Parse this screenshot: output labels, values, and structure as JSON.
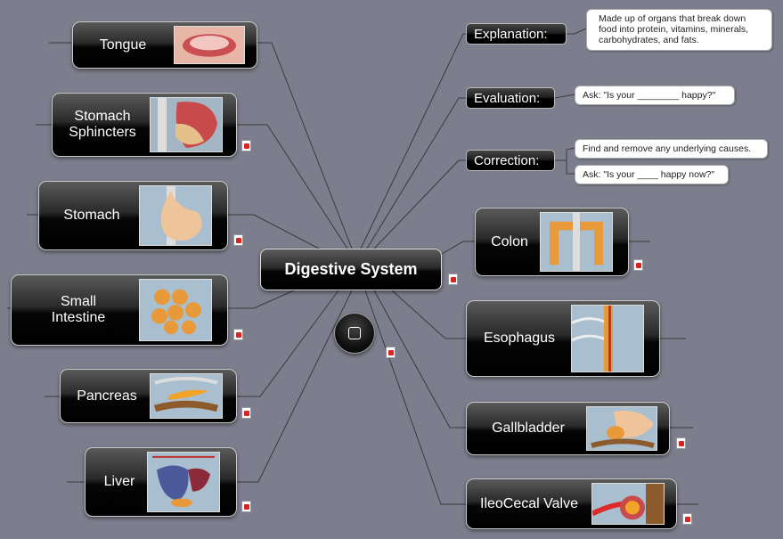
{
  "central_topic": "Digestive System",
  "left_topics": [
    {
      "label": "Tongue",
      "image": "tongue-image"
    },
    {
      "label": "Stomach\nSphincters",
      "image": "stomach-sphincters-image"
    },
    {
      "label": "Stomach",
      "image": "stomach-image"
    },
    {
      "label": "Small\nIntestine",
      "image": "small-intestine-image"
    },
    {
      "label": "Pancreas",
      "image": "pancreas-image"
    },
    {
      "label": "Liver",
      "image": "liver-image"
    }
  ],
  "right_small_topics": [
    {
      "label": "Explanation:"
    },
    {
      "label": "Evaluation:"
    },
    {
      "label": "Correction:"
    }
  ],
  "notes": {
    "explanation": "Made up of organs that break down food into protein, vitamins, minerals, carbohydrates, and fats.",
    "evaluation": "Ask: \"Is your ________ happy?\"",
    "correction_1": "Find and remove any underlying causes.",
    "correction_2": "Ask: \"Is your ____ happy now?\""
  },
  "right_topics": [
    {
      "label": "Colon",
      "image": "colon-image"
    },
    {
      "label": "Esophagus",
      "image": "esophagus-image"
    },
    {
      "label": "Gallbladder",
      "image": "gallbladder-image"
    },
    {
      "label": "IleoCecal Valve",
      "image": "ileocecal-valve-image"
    }
  ],
  "colors": {
    "background": "#7d7e8d",
    "node_fill": "#000000",
    "node_text": "#ffffff",
    "link_line": "#3a3a3a"
  }
}
